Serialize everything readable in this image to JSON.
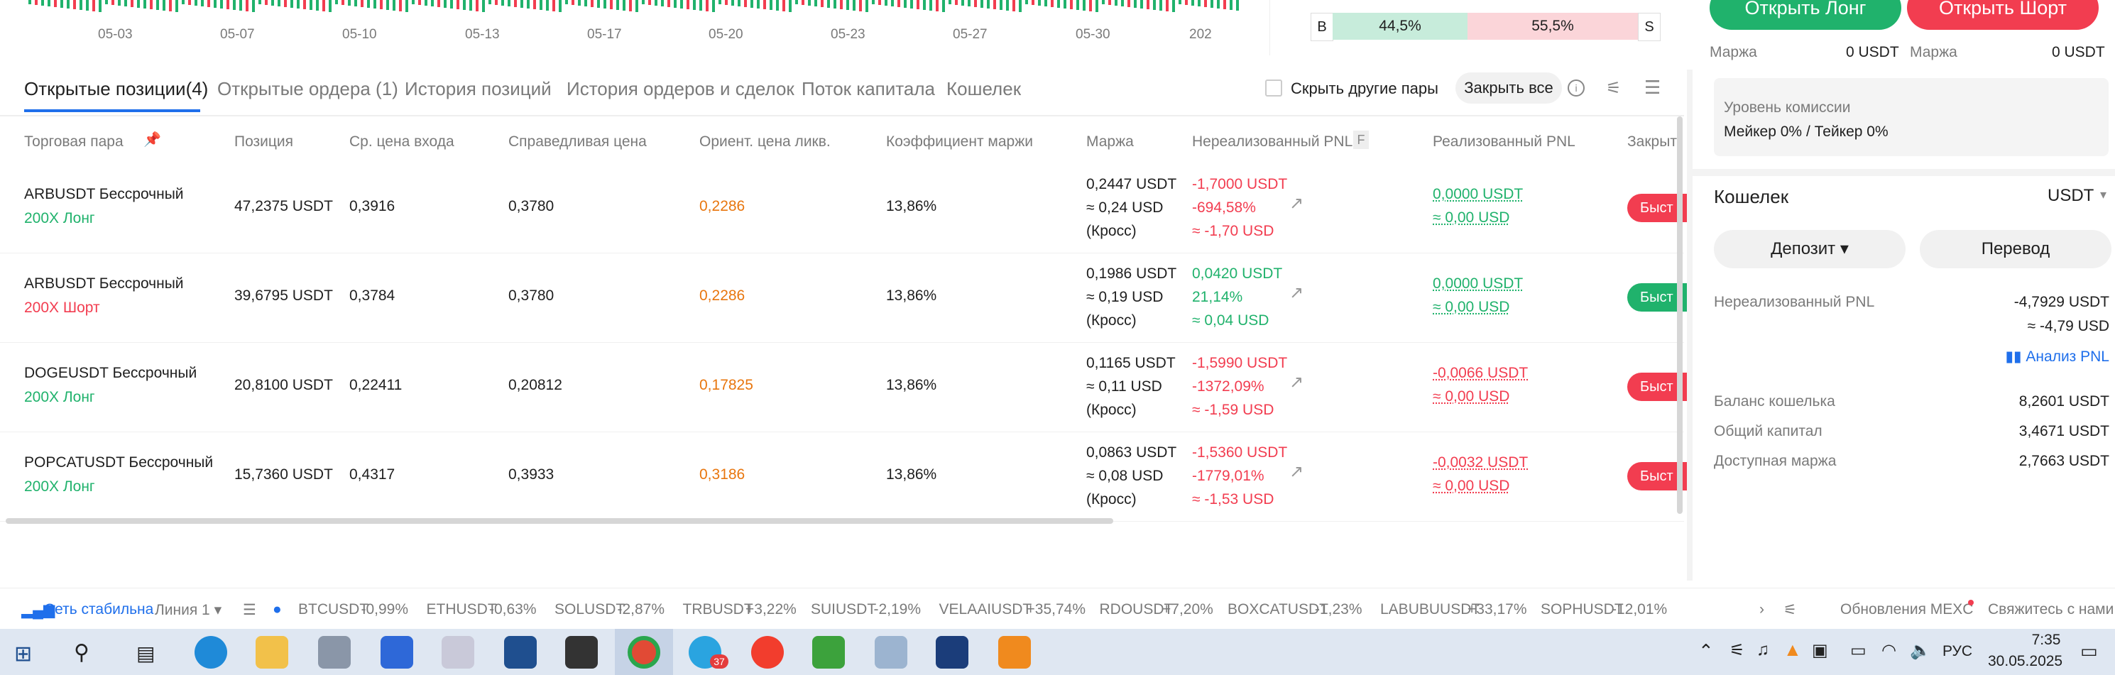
{
  "chart": {
    "dates": [
      "05-03",
      "05-07",
      "05-10",
      "05-13",
      "05-17",
      "05-20",
      "05-23",
      "05-27",
      "05-30",
      "202"
    ]
  },
  "order_panel": {
    "buy_pct": "44,5%",
    "sell_pct": "55,5%",
    "buy_side": "B",
    "sell_side": "S",
    "open_long_label": "Открыть Лонг",
    "open_short_label": "Открыть Шорт",
    "margin_label_long": "Маржа",
    "margin_value_long": "0 USDT",
    "margin_label_short": "Маржа",
    "margin_value_short": "0 USDT",
    "buy_color": "#20b26c",
    "sell_color": "#f23d50"
  },
  "tabs": [
    {
      "label": "Открытые позиции(4)",
      "active": true
    },
    {
      "label": "Открытые ордера (1)"
    },
    {
      "label": "История позиций"
    },
    {
      "label": "История ордеров и сделок"
    },
    {
      "label": "Поток капитала"
    },
    {
      "label": "Кошелек"
    }
  ],
  "tab_tools": {
    "hide_pairs_label": "Скрыть другие пары",
    "close_all_label": "Закрыть все"
  },
  "table": {
    "headers": [
      "Торговая пара",
      "Позиция",
      "Ср. цена входа",
      "Справедливая цена",
      "Ориент. цена ликв.",
      "Коэффициент маржи",
      "Маржа",
      "Нереализованный PNL",
      "Реализованный PNL",
      "Закрыт"
    ],
    "pnl_badge": "F",
    "rows": [
      {
        "pair": "ARBUSDT Бессрочный",
        "lev": "200X Лонг",
        "side": "long",
        "position": "47,2375 USDT",
        "entry": "0,3916",
        "fair": "0,3780",
        "liq": "0,2286",
        "ratio": "13,86%",
        "margin1": "0,2447 USDT",
        "margin2": "≈ 0,24 USD",
        "margin3": "(Кросс)",
        "upnl1": "-1,7000 USDT",
        "upnl2": "-694,58%",
        "upnl3": "≈ -1,70 USD",
        "upnl_sign": "neg",
        "rpnl1": "0,0000 USDT",
        "rpnl2": "≈ 0,00 USD",
        "rpnl_sign": "pos",
        "fast": "Быст"
      },
      {
        "pair": "ARBUSDT Бессрочный",
        "lev": "200X Шорт",
        "side": "short",
        "position": "39,6795 USDT",
        "entry": "0,3784",
        "fair": "0,3780",
        "liq": "0,2286",
        "ratio": "13,86%",
        "margin1": "0,1986 USDT",
        "margin2": "≈ 0,19 USD",
        "margin3": "(Кросс)",
        "upnl1": "0,0420 USDT",
        "upnl2": "21,14%",
        "upnl3": "≈ 0,04 USD",
        "upnl_sign": "pos",
        "rpnl1": "0,0000 USDT",
        "rpnl2": "≈ 0,00 USD",
        "rpnl_sign": "pos",
        "fast": "Быст"
      },
      {
        "pair": "DOGEUSDT Бессрочный",
        "lev": "200X Лонг",
        "side": "long",
        "position": "20,8100 USDT",
        "entry": "0,22411",
        "fair": "0,20812",
        "liq": "0,17825",
        "ratio": "13,86%",
        "margin1": "0,1165 USDT",
        "margin2": "≈ 0,11 USD",
        "margin3": "(Кросс)",
        "upnl1": "-1,5990 USDT",
        "upnl2": "-1372,09%",
        "upnl3": "≈ -1,59 USD",
        "upnl_sign": "neg",
        "rpnl1": "-0,0066 USDT",
        "rpnl2": "≈ 0,00 USD",
        "rpnl_sign": "neg",
        "fast": "Быст"
      },
      {
        "pair": "POPCATUSDT Бессрочный",
        "lev": "200X Лонг",
        "side": "long",
        "position": "15,7360 USDT",
        "entry": "0,4317",
        "fair": "0,3933",
        "liq": "0,3186",
        "ratio": "13,86%",
        "margin1": "0,0863 USDT",
        "margin2": "≈ 0,08 USD",
        "margin3": "(Кросс)",
        "upnl1": "-1,5360 USDT",
        "upnl2": "-1779,01%",
        "upnl3": "≈ -1,53 USD",
        "upnl_sign": "neg",
        "rpnl1": "-0,0032 USDT",
        "rpnl2": "≈ 0,00 USD",
        "rpnl_sign": "neg",
        "fast": "Быст"
      }
    ]
  },
  "right_panel": {
    "fee_title": "Уровень комиссии",
    "fee_value": "Мейкер 0% / Тейкер 0%",
    "wallet_title": "Кошелек",
    "currency": "USDT",
    "deposit_label": "Депозит",
    "transfer_label": "Перевод",
    "upnl_label": "Нереализованный PNL",
    "upnl_value": "-4,7929 USDT",
    "upnl_approx": "≈ -4,79 USD",
    "pnl_analysis": "Анализ PNL",
    "balance_label": "Баланс кошелька",
    "balance_value": "8,2601 USDT",
    "equity_label": "Общий капитал",
    "equity_value": "3,4671 USDT",
    "avail_label": "Доступная маржа",
    "avail_value": "2,7663 USDT"
  },
  "ticker": {
    "network": "Сеть стабильна",
    "line": "Линия 1",
    "items": [
      {
        "sym": "BTCUSDT",
        "chg": "-0,99%",
        "sign": "neg"
      },
      {
        "sym": "ETHUSDT",
        "chg": "-0,63%",
        "sign": "neg"
      },
      {
        "sym": "SOLUSDT",
        "chg": "-2,87%",
        "sign": "neg"
      },
      {
        "sym": "TRBUSDT",
        "chg": "+3,22%",
        "sign": "pos"
      },
      {
        "sym": "SUIUSDT",
        "chg": "-2,19%",
        "sign": "neg"
      },
      {
        "sym": "VELAAIUSDT",
        "chg": "+35,74%",
        "sign": "pos"
      },
      {
        "sym": "RDOUSDT",
        "chg": "+7,20%",
        "sign": "pos"
      },
      {
        "sym": "BOXCATUSDT",
        "chg": "-1,23%",
        "sign": "neg"
      },
      {
        "sym": "LABUBUUSDT",
        "chg": "+33,17%",
        "sign": "pos"
      },
      {
        "sym": "SOPHUSDT",
        "chg": "-12,01%",
        "sign": "neg"
      }
    ],
    "updates": "Обновления MEXC",
    "contact": "Свяжитесь с нами"
  },
  "taskbar": {
    "time": "7:35",
    "date": "30.05.2025",
    "lang": "РУС",
    "telegram_badge": "37"
  }
}
